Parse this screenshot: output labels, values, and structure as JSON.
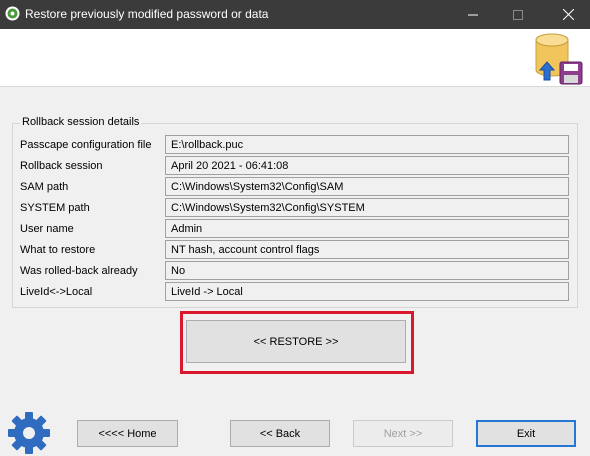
{
  "window": {
    "title": "Restore previously modified password or data"
  },
  "group": {
    "title": "Rollback session details"
  },
  "details": [
    {
      "label": "Passcape configuration file",
      "value": "E:\\rollback.puc"
    },
    {
      "label": "Rollback session",
      "value": "April 20 2021  - 06:41:08"
    },
    {
      "label": "SAM path",
      "value": "C:\\Windows\\System32\\Config\\SAM"
    },
    {
      "label": "SYSTEM path",
      "value": "C:\\Windows\\System32\\Config\\SYSTEM"
    },
    {
      "label": "User name",
      "value": "Admin"
    },
    {
      "label": "What to restore",
      "value": "NT hash, account control flags"
    },
    {
      "label": "Was rolled-back already",
      "value": "No"
    },
    {
      "label": "LiveId<->Local",
      "value": "LiveId -> Local"
    }
  ],
  "actions": {
    "restore_label": "<< RESTORE >>"
  },
  "footer": {
    "home_label": "<<<< Home",
    "back_label": "<< Back",
    "next_label": "Next >>",
    "exit_label": "Exit"
  },
  "colors": {
    "highlight": "#d9182d",
    "titlebar": "#3b3b3b",
    "default_button_border": "#2676d3"
  }
}
